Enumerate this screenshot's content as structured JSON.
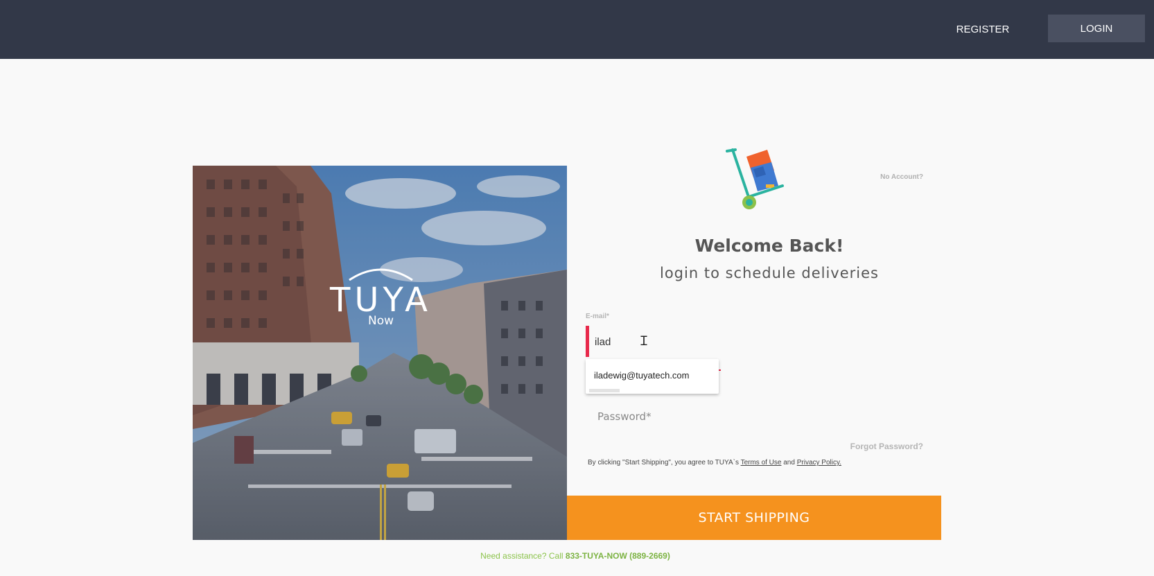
{
  "nav": {
    "register_label": "REGISTER",
    "login_label": "LOGIN"
  },
  "hero": {
    "logo_word": "TUYA",
    "logo_sub": "Now"
  },
  "login": {
    "no_account": "No Account?",
    "welcome_title": "Welcome Back!",
    "welcome_subtitle": "login to schedule deliveries",
    "email_label": "E-mail*",
    "email_value": "ilad",
    "autocomplete_suggestion": "iladewig@tuyatech.com",
    "password_placeholder": "Password*",
    "forgot_password": "Forgot Password?",
    "terms_prefix": "By clicking \"Start Shipping\", you agree to TUYA`s",
    "terms_link": "Terms of Use",
    "terms_and": "and",
    "privacy_link": "Privacy Policy.",
    "submit_label": "START SHIPPING"
  },
  "footer": {
    "assist_text": "Need assistance? Call",
    "assist_phone": "833-TUYA-NOW (889-2669)"
  },
  "colors": {
    "topbar": "#323848",
    "accent_orange": "#f5921e",
    "error_red": "#e8294b",
    "assist_green": "#8bc34a"
  }
}
